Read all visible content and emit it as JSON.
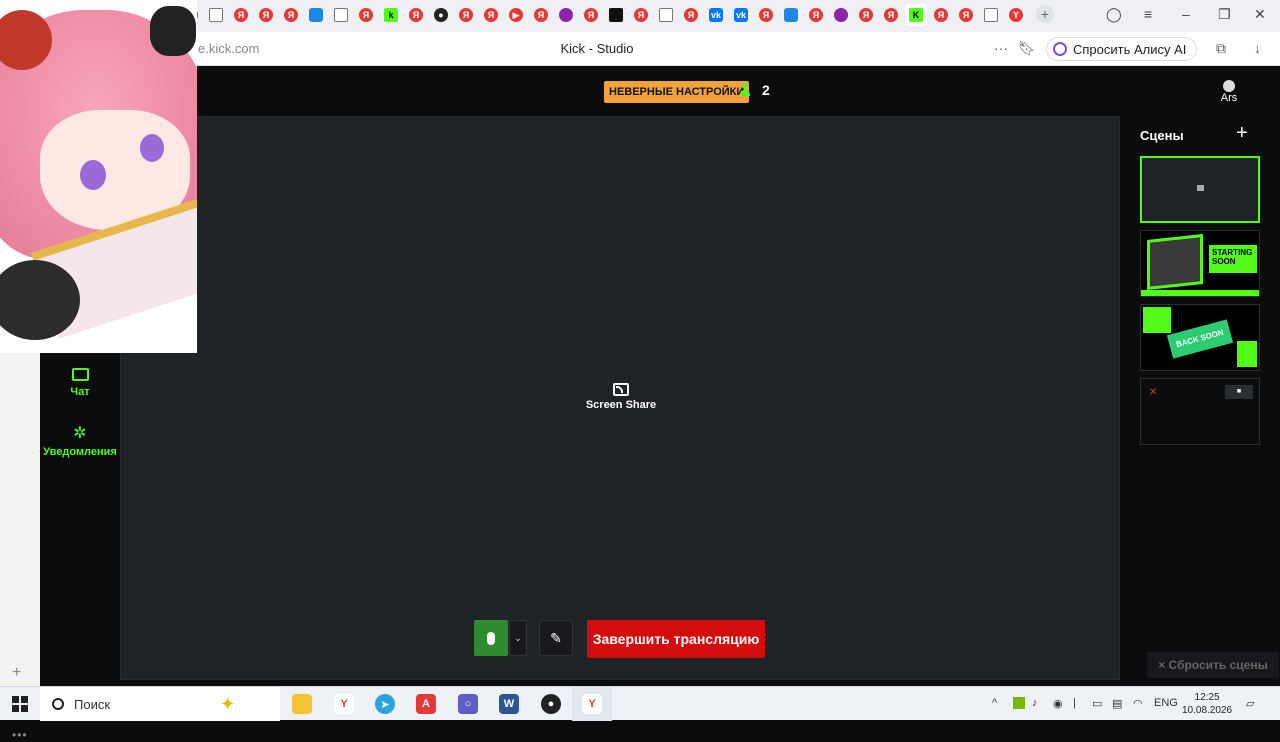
{
  "browser": {
    "url": "e.kick.com",
    "page_title": "Kick - Studio",
    "alice_label": "Спросить Алису AI",
    "tabs": [
      {
        "icon": "yandex-icon",
        "glyph": "Я",
        "cls": "fav-ya"
      },
      {
        "icon": "doc-icon",
        "glyph": "",
        "cls": "fav-doc"
      },
      {
        "icon": "yandex-icon",
        "glyph": "Я",
        "cls": "fav-ya"
      },
      {
        "icon": "yandex-icon",
        "glyph": "Я",
        "cls": "fav-ya"
      },
      {
        "icon": "yandex-icon",
        "glyph": "Я",
        "cls": "fav-ya"
      },
      {
        "icon": "chat-tab-icon",
        "glyph": "",
        "cls": "fav-blue"
      },
      {
        "icon": "doc-icon",
        "glyph": "",
        "cls": "fav-doc"
      },
      {
        "icon": "yandex-icon",
        "glyph": "Я",
        "cls": "fav-ya"
      },
      {
        "icon": "kick-k-icon",
        "glyph": "k",
        "cls": "fav-k"
      },
      {
        "icon": "yandex-icon",
        "glyph": "Я",
        "cls": "fav-ya"
      },
      {
        "icon": "github-icon",
        "glyph": "●",
        "cls": "fav-gh"
      },
      {
        "icon": "yandex-icon",
        "glyph": "Я",
        "cls": "fav-ya"
      },
      {
        "icon": "yandex-icon",
        "glyph": "Я",
        "cls": "fav-ya"
      },
      {
        "icon": "youtube-icon",
        "glyph": "▶",
        "cls": "fav-ya"
      },
      {
        "icon": "yandex-icon",
        "glyph": "Я",
        "cls": "fav-ya"
      },
      {
        "icon": "audio-icon",
        "glyph": "",
        "cls": "fav-purple"
      },
      {
        "icon": "yandex-icon",
        "glyph": "Я",
        "cls": "fav-ya"
      },
      {
        "icon": "tiktok-icon",
        "glyph": "",
        "cls": "fav-tk"
      },
      {
        "icon": "yandex-icon",
        "glyph": "Я",
        "cls": "fav-ya"
      },
      {
        "icon": "doc-icon",
        "glyph": "",
        "cls": "fav-doc"
      },
      {
        "icon": "yandex-icon",
        "glyph": "Я",
        "cls": "fav-ya"
      },
      {
        "icon": "vk-icon",
        "glyph": "vk",
        "cls": "fav-vk"
      },
      {
        "icon": "vk-icon",
        "glyph": "vk",
        "cls": "fav-vk"
      },
      {
        "icon": "yandex-icon",
        "glyph": "Я",
        "cls": "fav-ya"
      },
      {
        "icon": "globe-icon",
        "glyph": "",
        "cls": "fav-blue"
      },
      {
        "icon": "yandex-icon",
        "glyph": "Я",
        "cls": "fav-ya"
      },
      {
        "icon": "color-icon",
        "glyph": "",
        "cls": "fav-purple"
      },
      {
        "icon": "yandex-icon",
        "glyph": "Я",
        "cls": "fav-ya"
      },
      {
        "icon": "yandex-icon",
        "glyph": "Я",
        "cls": "fav-ya"
      },
      {
        "icon": "kick-k-icon",
        "glyph": "K",
        "cls": "fav-k",
        "active": true
      },
      {
        "icon": "yandex-icon",
        "glyph": "Я",
        "cls": "fav-ya"
      },
      {
        "icon": "yandex-icon",
        "glyph": "Я",
        "cls": "fav-ya"
      },
      {
        "icon": "doc-icon",
        "glyph": "",
        "cls": "fav-doc"
      },
      {
        "icon": "yandex-y-icon",
        "glyph": "Y",
        "cls": "fav-ya"
      }
    ]
  },
  "studio": {
    "warning_badge": "НЕВЕРНЫЕ НАСТРОЙКИ",
    "viewer_count": "2",
    "avatar_label": "Ars",
    "nav": {
      "chat": "Чат",
      "notifications": "Уведомления"
    },
    "canvas": {
      "source_label": "Screen Share"
    },
    "controls": {
      "end_stream": "Завершить трансляцию"
    },
    "scenes": {
      "title": "Сцены",
      "reset": "× Сбросить сцены",
      "starting_soon": "STARTING SOON",
      "back_soon": "BACK SOON"
    }
  },
  "taskbar": {
    "search_placeholder": "Поиск",
    "lang": "ENG",
    "time": "12:25",
    "date": "10.08.2026"
  },
  "colors": {
    "kick_green": "#53fc18",
    "warning": "#f2a33c",
    "end_red": "#d30d0d",
    "canvas_bg": "#1f2227"
  }
}
